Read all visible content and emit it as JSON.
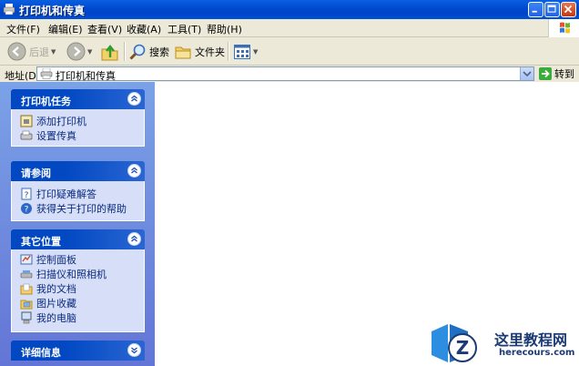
{
  "window": {
    "title": "打印机和传真"
  },
  "menu": [
    "文件(F)",
    "编辑(E)",
    "查看(V)",
    "收藏(A)",
    "工具(T)",
    "帮助(H)"
  ],
  "toolbar": {
    "back": "后退",
    "search": "搜索",
    "folders": "文件夹"
  },
  "address": {
    "label": "地址(D)",
    "value": "打印机和传真",
    "go": "转到"
  },
  "panels": {
    "printer_tasks": {
      "title": "打印机任务",
      "items": [
        "添加打印机",
        "设置传真"
      ]
    },
    "see_also": {
      "title": "请参阅",
      "items": [
        "打印疑难解答",
        "获得关于打印的帮助"
      ]
    },
    "other_places": {
      "title": "其它位置",
      "items": [
        "控制面板",
        "扫描仪和照相机",
        "我的文档",
        "图片收藏",
        "我的电脑"
      ]
    },
    "details": {
      "title": "详细信息"
    }
  },
  "watermark": {
    "name": "这里教程网",
    "url": "herecours.com"
  },
  "colors": {
    "title_bar": "#0054e3",
    "panel_header": "#0148c2",
    "panel_body": "#d6dff7",
    "link": "#0c2b7f"
  }
}
